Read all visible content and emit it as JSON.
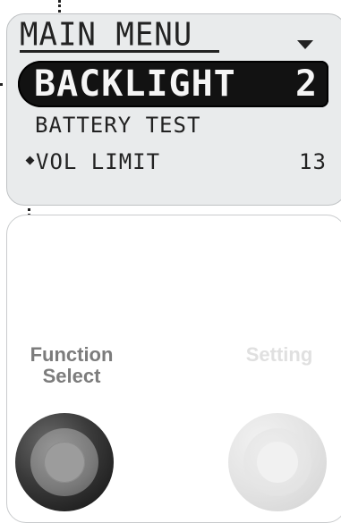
{
  "lcd": {
    "title": "MAIN MENU",
    "selected_item": {
      "label": "BACKLIGHT",
      "value": "2"
    },
    "items": [
      {
        "label": "BATTERY TEST",
        "value": ""
      },
      {
        "label": "VOL LIMIT",
        "value": "13"
      }
    ]
  },
  "controls": {
    "function_select": {
      "label_line1": "Function",
      "label_line2": "Select"
    },
    "setting": {
      "label": "Setting"
    }
  },
  "colors": {
    "lcd_background": "#e9ebec",
    "lcd_text": "#222222",
    "selected_bar": "#121212",
    "function_label": "#7c7c7c",
    "setting_label": "#e0e0e0"
  },
  "icons": {
    "dropdown": "down-arrow-triangle",
    "item_marker": "diamond"
  }
}
